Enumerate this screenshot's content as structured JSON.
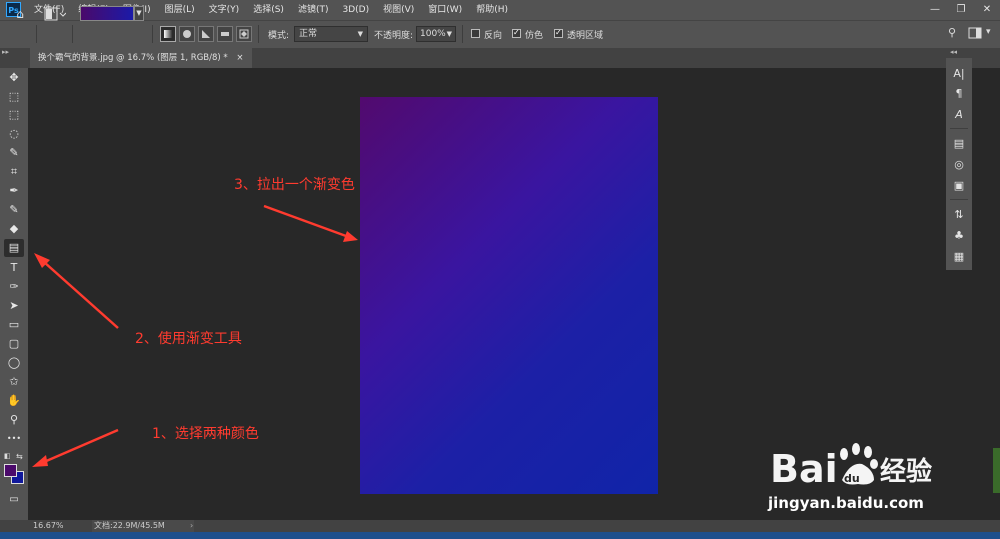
{
  "app": {
    "logo": "Ps"
  },
  "menu": [
    "文件(F)",
    "编辑(E)",
    "图像(I)",
    "图层(L)",
    "文字(Y)",
    "选择(S)",
    "滤镜(T)",
    "3D(D)",
    "视图(V)",
    "窗口(W)",
    "帮助(H)"
  ],
  "window_controls": {
    "minimize": "—",
    "restore": "❐",
    "close": "✕"
  },
  "options": {
    "gradient_colors": [
      "#4a0a6a",
      "#1b1aa8"
    ],
    "mode_label": "模式:",
    "mode_value": "正常",
    "opacity_label": "不透明度:",
    "opacity_value": "100%",
    "reverse_label": "反向",
    "reverse_checked": false,
    "dither_label": "仿色",
    "dither_checked": true,
    "transparency_label": "透明区域",
    "transparency_checked": true
  },
  "document": {
    "tab_title": "换个霸气的背景.jpg @ 16.7% (图层 1, RGB/8) *",
    "close_icon": "×",
    "gradient": [
      "#520a6e",
      "#1024a8"
    ]
  },
  "tools": [
    {
      "name": "move-tool",
      "icon": "✥"
    },
    {
      "name": "artboard-tool",
      "icon": "⬚"
    },
    {
      "name": "marquee-tool",
      "icon": "⬚"
    },
    {
      "name": "lasso-tool",
      "icon": "◌"
    },
    {
      "name": "quick-select-tool",
      "icon": "✎"
    },
    {
      "name": "crop-tool",
      "icon": "⌗"
    },
    {
      "name": "eyedropper-tool",
      "icon": "✒"
    },
    {
      "name": "brush-tool",
      "icon": "✎"
    },
    {
      "name": "eraser-tool",
      "icon": "◆"
    },
    {
      "name": "gradient-tool",
      "icon": "▤"
    },
    {
      "name": "type-tool",
      "icon": "T"
    },
    {
      "name": "pen-tool",
      "icon": "✑"
    },
    {
      "name": "path-select-tool",
      "icon": "➤"
    },
    {
      "name": "rectangle-tool",
      "icon": "▭"
    },
    {
      "name": "rounded-rect-tool",
      "icon": "▢"
    },
    {
      "name": "ellipse-tool",
      "icon": "◯"
    },
    {
      "name": "shape-tool",
      "icon": "✩"
    },
    {
      "name": "hand-tool",
      "icon": "✋"
    },
    {
      "name": "zoom-tool",
      "icon": "⚲"
    },
    {
      "name": "more-tools",
      "icon": "•••"
    }
  ],
  "colors": {
    "foreground": "#4b0a6b",
    "background": "#10189b"
  },
  "right_panel": [
    "A|",
    "¶",
    "A",
    "▤",
    "◎",
    "▣",
    "⇅",
    "♣",
    "▦"
  ],
  "status": {
    "zoom": "16.67%",
    "doc": "文档:22.9M/45.5M"
  },
  "annotations": {
    "step1": "1、选择两种颜色",
    "step2": "2、使用渐变工具",
    "step3": "3、拉出一个渐变色"
  },
  "watermark": {
    "url": "jingyan.baidu.com"
  }
}
